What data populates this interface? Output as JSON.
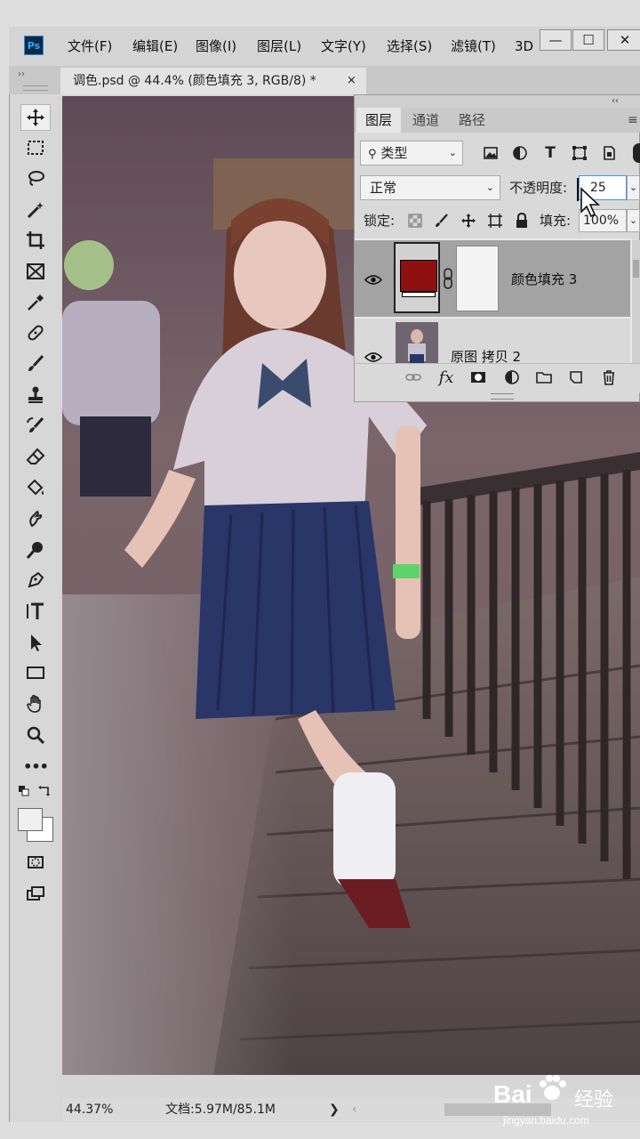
{
  "app": {
    "logo": "Ps",
    "menus": [
      "文件(F)",
      "编辑(E)",
      "图像(I)",
      "图层(L)",
      "文字(Y)",
      "选择(S)",
      "滤镜(T)",
      "3D"
    ],
    "window_controls": {
      "minimize": "—",
      "restore": "☐",
      "close": "✕"
    }
  },
  "document_tab": {
    "title": "调色.psd @ 44.4% (颜色填充 3, RGB/8) *",
    "close": "×"
  },
  "toolbar": {
    "collapse": "››",
    "tools": [
      "move-tool",
      "marquee-tool",
      "lasso-tool",
      "magic-wand-tool",
      "crop-tool",
      "frame-tool",
      "eyedropper-tool",
      "healing-brush-tool",
      "brush-tool",
      "clone-stamp-tool",
      "history-brush-tool",
      "eraser-tool",
      "paint-bucket-tool",
      "smudge-tool",
      "dodge-tool",
      "pen-tool",
      "type-tool",
      "path-selection-tool",
      "rectangle-tool",
      "hand-tool",
      "zoom-tool",
      "more-tools",
      "color-swatches",
      "quick-mask",
      "screen-mode"
    ],
    "active_tool": "move-tool",
    "more_label": "•••"
  },
  "layers_panel": {
    "tabs": [
      "图层",
      "通道",
      "路径"
    ],
    "active_tab": "图层",
    "collapse": "‹‹",
    "menu": "≡",
    "filter": {
      "label": "类型",
      "icons": [
        "image-filter-icon",
        "adjustment-filter-icon",
        "type-filter-icon",
        "shape-filter-icon",
        "smart-object-filter-icon"
      ]
    },
    "blend_mode": "正常",
    "opacity_label": "不透明度:",
    "opacity_value": "25",
    "lock_label": "锁定:",
    "fill_label": "填充:",
    "fill_value": "100%",
    "layers": [
      {
        "name": "颜色填充 3",
        "type": "color-fill",
        "color": "#8f1010",
        "selected": true,
        "visible": true
      },
      {
        "name": "原图 拷贝 2",
        "type": "pixel",
        "selected": false,
        "visible": true
      }
    ],
    "footer_icons": [
      "link-layers-icon",
      "fx-icon",
      "add-mask-icon",
      "adjustment-layer-icon",
      "group-folder-icon",
      "new-layer-icon",
      "delete-layer-icon"
    ],
    "fx_label": "fx"
  },
  "statusbar": {
    "zoom": "44.37%",
    "doc_info": "文档:5.97M/85.1M",
    "arrow": "❯",
    "scroll_left": "‹"
  },
  "watermark": {
    "brand": "Bai",
    "brand_cn": "经验",
    "url": "jingyan.baidu.com"
  },
  "colors": {
    "accent": "#4a90e2",
    "fill_layer": "#8f1010",
    "panel_bg": "#d9d9d9",
    "selected_row": "#a3a3a3"
  }
}
